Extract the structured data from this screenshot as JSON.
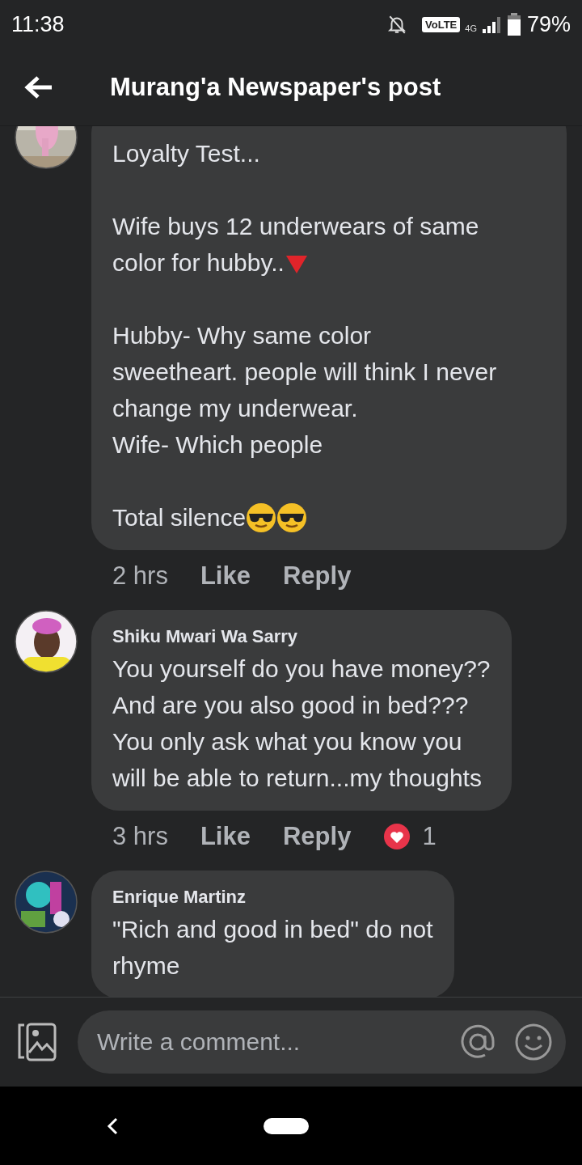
{
  "status_bar": {
    "time": "11:38",
    "network_badge": "VoLTE",
    "network_type": "4G",
    "battery": "79%"
  },
  "header": {
    "title": "Murang'a Newspaper's post"
  },
  "comments": [
    {
      "paragraphs": [
        [
          {
            "text": "Loyalty Test...",
            "kind": "plain"
          }
        ],
        [
          {
            "text": "Wife buys 12 underwears of same",
            "kind": "plain"
          },
          {
            "text": "color for hubby..",
            "kind": "alert"
          }
        ],
        [
          {
            "text": "Hubby- Why same color",
            "kind": "plain"
          },
          {
            "text": "sweetheart. people will think I never",
            "kind": "plain"
          },
          {
            "text": "change my underwear.",
            "kind": "plain"
          },
          {
            "text": "Wife- Which people",
            "kind": "plain"
          }
        ],
        [
          {
            "text": "Total silence",
            "kind": "cool"
          }
        ]
      ],
      "time": "2 hrs",
      "like": "Like",
      "reply": "Reply"
    },
    {
      "name": "Shiku Mwari Wa Sarry",
      "paragraphs": [
        [
          {
            "text": "You yourself do you have money??",
            "kind": "plain"
          },
          {
            "text": "And are you also good in bed???",
            "kind": "plain"
          },
          {
            "text": "You only ask what you know you",
            "kind": "plain"
          },
          {
            "text": "will be able to return...my thoughts",
            "kind": "plain"
          }
        ]
      ],
      "time": "3 hrs",
      "like": "Like",
      "reply": "Reply",
      "reaction_count": "1"
    },
    {
      "name": "Enrique Martinz",
      "paragraphs": [
        [
          {
            "text": "\"Rich and good in bed\" do not",
            "kind": "plain"
          },
          {
            "text": "rhyme",
            "kind": "plain"
          }
        ]
      ]
    }
  ],
  "composer": {
    "placeholder": "Write a comment..."
  }
}
